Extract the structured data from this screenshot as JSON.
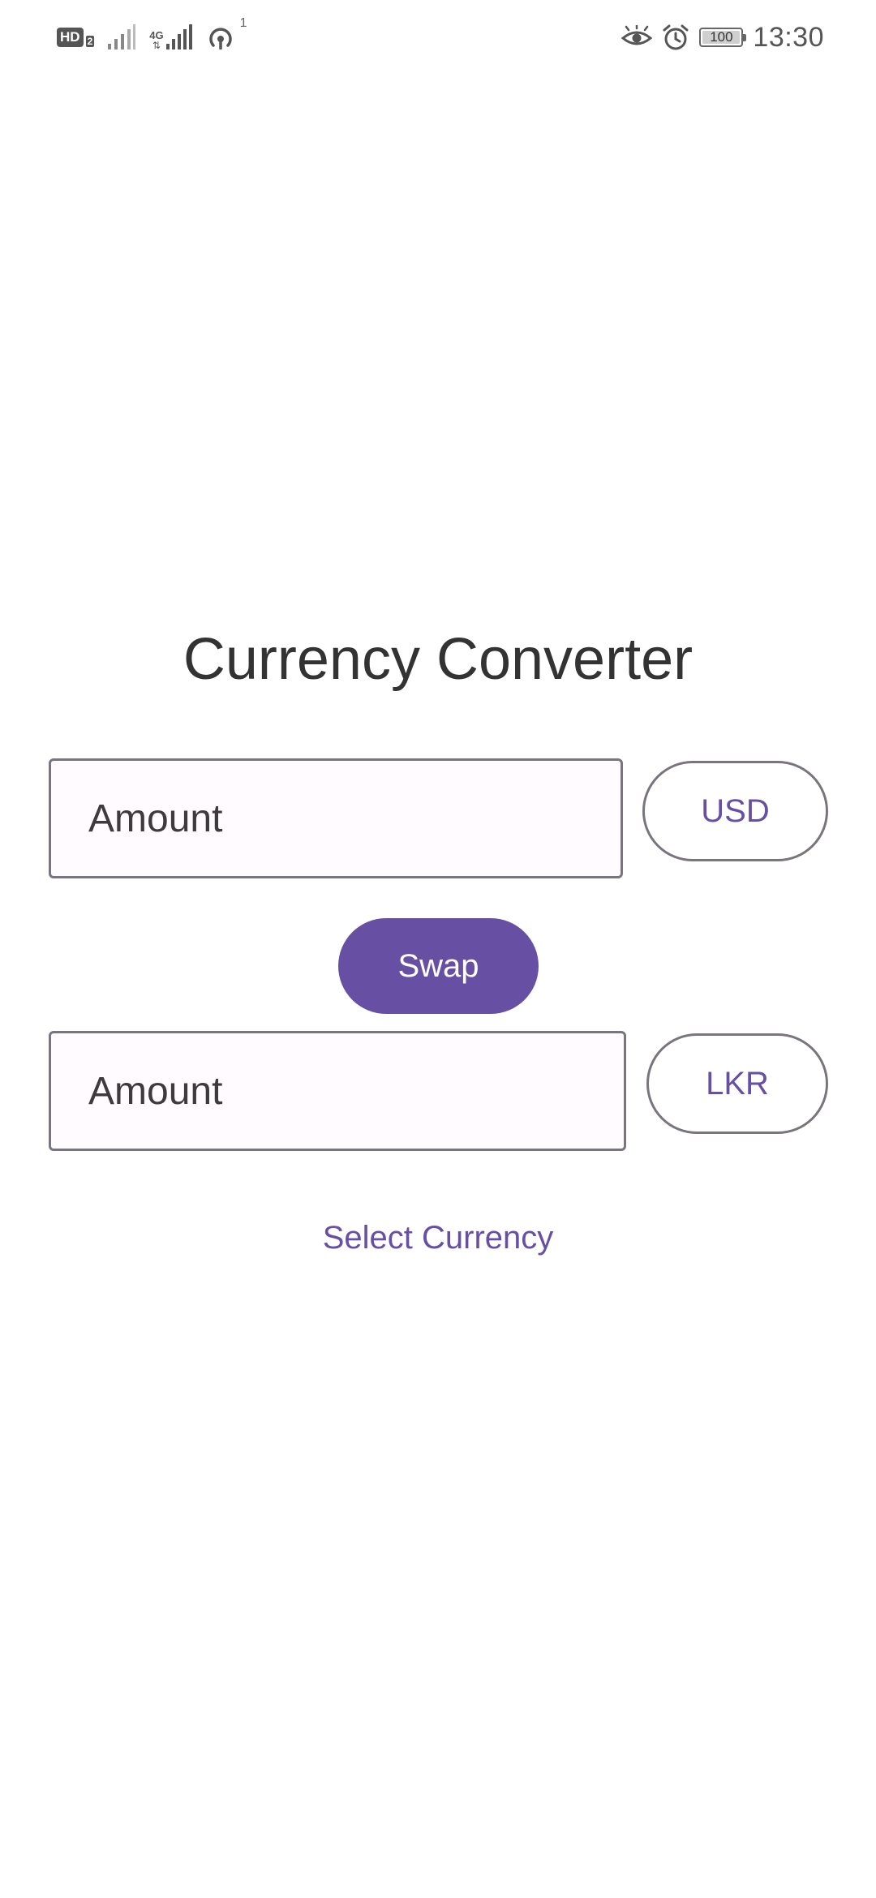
{
  "status_bar": {
    "hd_label": "HD",
    "sim_label": "2",
    "network_label": "4G",
    "hotspot_superscript": "1",
    "battery_level": "100",
    "time": "13:30",
    "icons": [
      "hd-icon",
      "signal-icon",
      "signal-4g-icon",
      "hotspot-icon",
      "eye-icon",
      "alarm-icon",
      "battery-icon"
    ]
  },
  "app": {
    "title": "Currency Converter",
    "from_field": {
      "placeholder": "Amount",
      "value": ""
    },
    "from_currency": "USD",
    "swap_label": "Swap",
    "to_field": {
      "placeholder": "Amount",
      "value": ""
    },
    "to_currency": "LKR",
    "select_currency_label": "Select Currency"
  },
  "colors": {
    "primary": "#6750a4",
    "outline": "#79747e",
    "field_background": "#fffbfe",
    "title_text": "#333333"
  }
}
